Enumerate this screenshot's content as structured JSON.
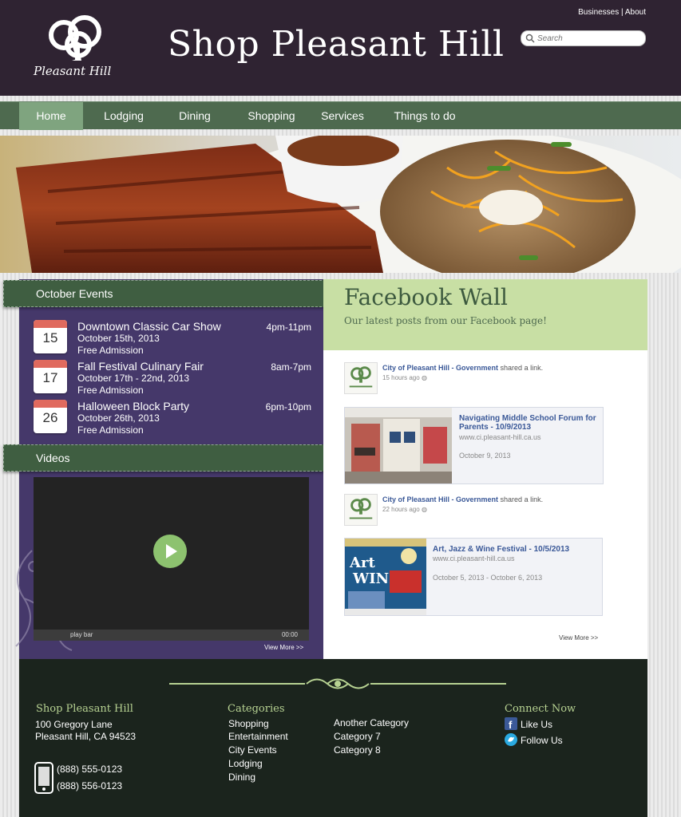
{
  "header": {
    "logo_text": "Pleasant Hill",
    "site_title": "Shop Pleasant Hill",
    "top_links": [
      "Businesses",
      "About"
    ],
    "search_placeholder": "Search"
  },
  "nav": {
    "items": [
      "Home",
      "Lodging",
      "Dining",
      "Shopping",
      "Services",
      "Things to do"
    ],
    "active": "Home"
  },
  "events": {
    "heading": "October Events",
    "items": [
      {
        "day": "15",
        "title": "Downtown Classic Car Show",
        "date": "October 15th, 2013",
        "admission": "Free Admission",
        "time": "4pm-11pm"
      },
      {
        "day": "17",
        "title": "Fall Festival Culinary Fair",
        "date": "October 17th - 22nd, 2013",
        "admission": "Free Admission",
        "time": "8am-7pm"
      },
      {
        "day": "26",
        "title": "Halloween Block Party",
        "date": "October 26th, 2013",
        "admission": "Free Admission",
        "time": "6pm-10pm"
      }
    ]
  },
  "videos": {
    "heading": "Videos",
    "play_bar_label": "play bar",
    "time": "00:00",
    "view_more": "View More >>"
  },
  "facebook": {
    "title": "Facebook Wall",
    "subtitle": "Our latest posts from our Facebook page!",
    "posts": [
      {
        "author": "City of Pleasant Hill - Government",
        "action": "shared a link.",
        "time": "15 hours ago",
        "link_title": "Navigating Middle School Forum for Parents - 10/9/2013",
        "link_url": "www.ci.pleasant-hill.ca.us",
        "link_date": "October 9, 2013"
      },
      {
        "author": "City of Pleasant Hill - Government",
        "action": "shared a link.",
        "time": "22 hours ago",
        "link_title": "Art, Jazz & Wine Festival - 10/5/2013",
        "link_url": "www.ci.pleasant-hill.ca.us",
        "link_date": "October 5, 2013 - October 6, 2013"
      }
    ],
    "view_more": "View More >>"
  },
  "footer": {
    "site": {
      "heading": "Shop Pleasant Hill",
      "address1": "100 Gregory Lane",
      "address2": "Pleasant Hill, CA 94523",
      "phone1": "(888) 555-0123",
      "phone2": "(888) 556-0123"
    },
    "categories": {
      "heading": "Categories",
      "col1": [
        "Shopping",
        "Entertainment",
        "City Events",
        "Lodging",
        "Dining"
      ],
      "col2": [
        "Another Category",
        "Category 7",
        "Category 8"
      ]
    },
    "connect": {
      "heading": "Connect Now",
      "facebook": "Like Us",
      "twitter": "Follow Us"
    }
  },
  "colors": {
    "header_bg": "#2f2332",
    "nav_bg": "#4e6a4f",
    "nav_active": "#7fa47f",
    "events_bg": "#45386a",
    "fb_header_bg": "#c8dfa4",
    "footer_bg": "#1b241d"
  }
}
